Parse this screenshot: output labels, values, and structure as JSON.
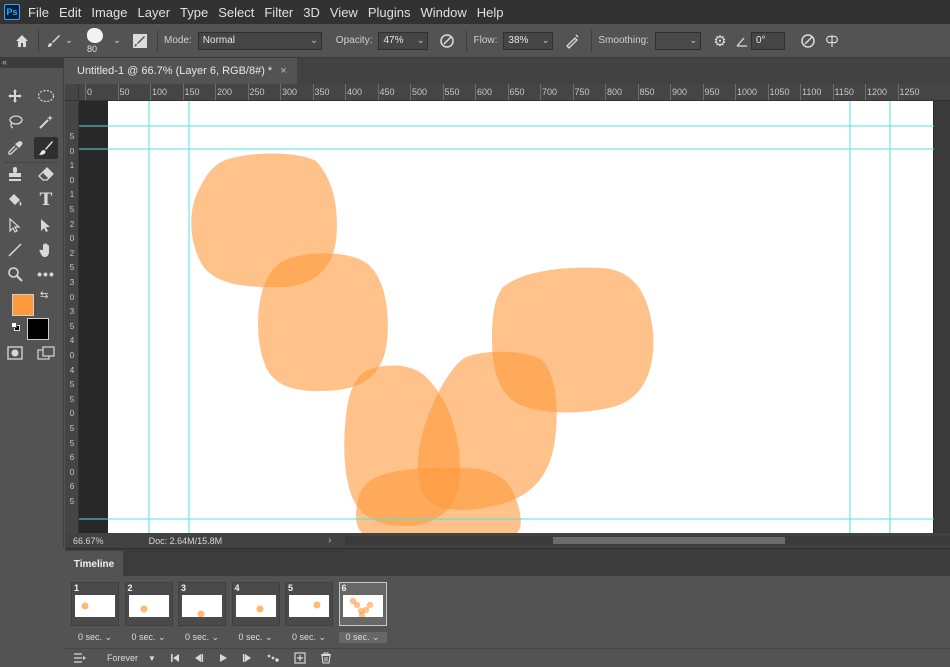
{
  "app": {
    "logo_text": "Ps"
  },
  "menu": [
    "File",
    "Edit",
    "Image",
    "Layer",
    "Type",
    "Select",
    "Filter",
    "3D",
    "View",
    "Plugins",
    "Window",
    "Help"
  ],
  "options": {
    "brush_size": "80",
    "mode_label": "Mode:",
    "mode_value": "Normal",
    "opacity_label": "Opacity:",
    "opacity_value": "47%",
    "flow_label": "Flow:",
    "flow_value": "38%",
    "smoothing_label": "Smoothing:",
    "smoothing_value": "",
    "angle_value": "0°"
  },
  "document": {
    "tab_title": "Untitled-1 @ 66.7% (Layer 6, RGB/8#) *",
    "close_glyph": "×"
  },
  "ruler": {
    "h_labels": [
      "0",
      "50",
      "100",
      "150",
      "200",
      "250",
      "300",
      "350",
      "400",
      "450",
      "500",
      "550",
      "600",
      "650",
      "700",
      "750",
      "800",
      "850",
      "900",
      "950",
      "1000",
      "1050",
      "1100",
      "1150",
      "1200",
      "1250"
    ],
    "v_labels": [
      "5",
      "0",
      "1",
      "0",
      "1",
      "5",
      "2",
      "0",
      "2",
      "5",
      "3",
      "0",
      "3",
      "5",
      "4",
      "0",
      "4",
      "5",
      "5",
      "0",
      "5",
      "5",
      "6",
      "0",
      "6",
      "5"
    ]
  },
  "colors": {
    "foreground": "#ff9a3c",
    "background": "#000000",
    "stroke": "#ff9a3c",
    "guide": "#4fe3e3"
  },
  "status": {
    "zoom": "66.67%",
    "doc": "Doc: 2.64M/15.8M",
    "arrow": "›"
  },
  "timeline": {
    "tab_label": "Timeline",
    "frames": [
      {
        "num": "1",
        "delay": "0 sec."
      },
      {
        "num": "2",
        "delay": "0 sec."
      },
      {
        "num": "3",
        "delay": "0 sec."
      },
      {
        "num": "4",
        "delay": "0 sec."
      },
      {
        "num": "5",
        "delay": "0 sec."
      },
      {
        "num": "6",
        "delay": "0 sec."
      }
    ],
    "loop": "Forever"
  },
  "tools": {
    "left_column": [
      "move-tool-icon",
      "lasso-tool-icon",
      "eyedropper-tool-icon",
      "clone-stamp-tool-icon",
      "paint-bucket-tool-icon",
      "path-selection-tool-icon",
      "line-tool-icon",
      "zoom-tool-icon"
    ],
    "right_column": [
      "marquee-tool-icon",
      "magic-wand-tool-icon",
      "brush-tool-icon",
      "eraser-tool-icon",
      "type-tool-icon",
      "direct-selection-tool-icon",
      "hand-tool-icon",
      "more-tools-icon"
    ]
  }
}
